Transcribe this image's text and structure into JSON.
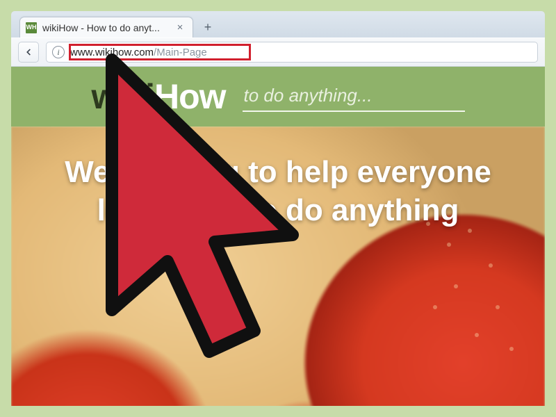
{
  "browser": {
    "tab": {
      "title": "wikiHow - How to do anyt..."
    },
    "address": {
      "domain": "www.wikihow.com",
      "path": "/Main-Page",
      "full": "www.wikihow.com/Main-Page"
    }
  },
  "favicon": {
    "text": "WH"
  },
  "wikihow": {
    "logo_wiki": "wiki",
    "logo_how": "How",
    "search_placeholder": "to do anything...",
    "hero_line1": "We're trying to help everyone",
    "hero_line2": "learn how to do anything"
  }
}
